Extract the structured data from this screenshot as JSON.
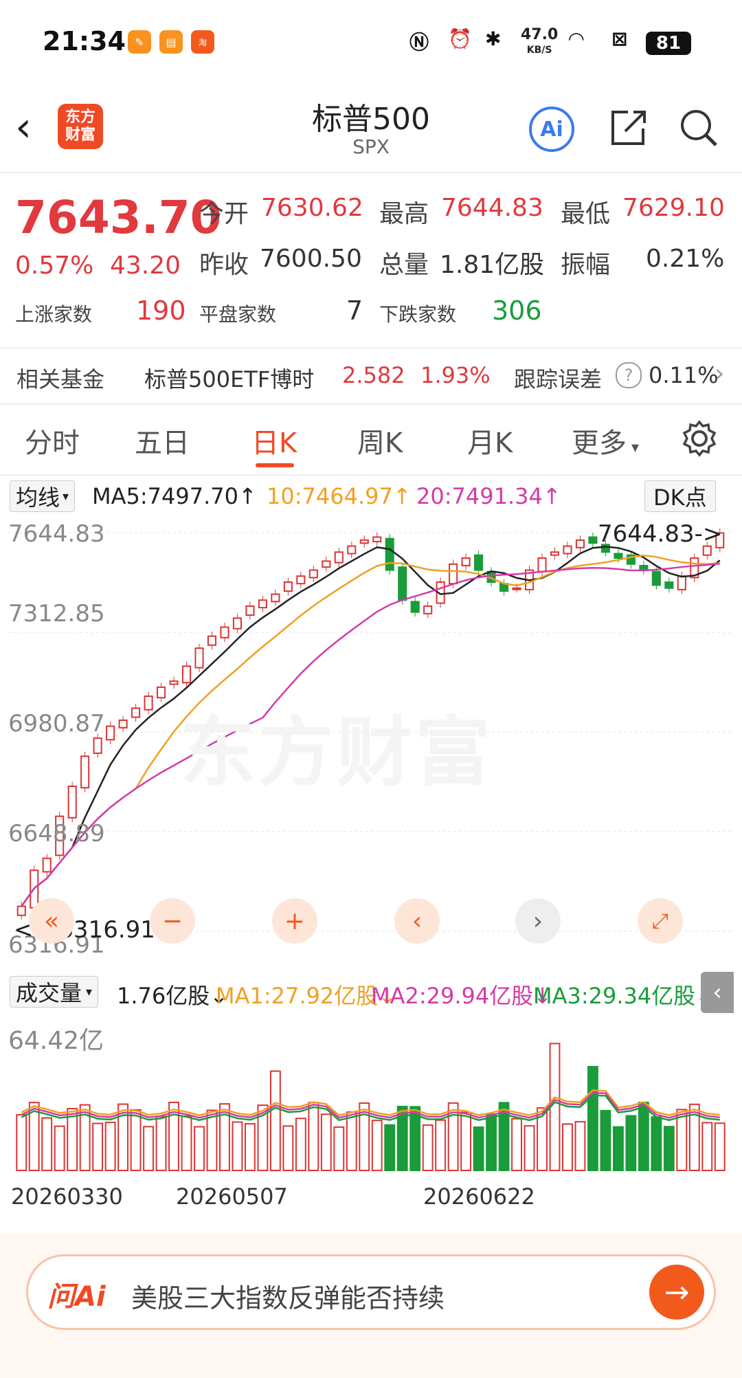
{
  "status_bar": {
    "time": "21:34",
    "network_speed": "47.0",
    "network_unit": "KB/S",
    "battery": "81"
  },
  "header": {
    "title": "标普500",
    "subtitle": "SPX",
    "logo_text_top": "东方",
    "logo_text_bottom": "财富",
    "ai_label": "Ai"
  },
  "quote": {
    "price": "7643.70",
    "change_pct": "0.57%",
    "change_val": "43.20",
    "open_label": "今开",
    "open": "7630.62",
    "high_label": "最高",
    "high": "7644.83",
    "low_label": "最低",
    "low": "7629.10",
    "prev_close_label": "昨收",
    "prev_close": "7600.50",
    "volume_label": "总量",
    "volume": "1.81亿股",
    "amplitude_label": "振幅",
    "amplitude": "0.21%",
    "up_label": "上涨家数",
    "up_count": "190",
    "flat_label": "平盘家数",
    "flat_count": "7",
    "down_label": "下跌家数",
    "down_count": "306"
  },
  "fund": {
    "label": "相关基金",
    "name": "标普500ETF博时",
    "price": "2.582",
    "pct": "1.93%",
    "tracking_label": "跟踪误差",
    "tracking_value": "0.11%"
  },
  "tabs": [
    "分时",
    "五日",
    "日K",
    "周K",
    "月K",
    "更多"
  ],
  "active_tab": "日K",
  "ma": {
    "selector": "均线",
    "ma5": "MA5:7497.70↑",
    "ma10": "10:7464.97↑",
    "ma20": "20:7491.34↑",
    "dk_button": "DK点",
    "ma10_color": "#f0a020",
    "ma20_color": "#d43aa8"
  },
  "main_chart": {
    "y_labels": [
      "7644.83",
      "7312.85",
      "6980.87",
      "6648.89",
      "6316.91"
    ],
    "high_marker": "7644.83->",
    "low_marker": "<---6316.91",
    "watermark": "东方财富"
  },
  "volume": {
    "selector": "成交量",
    "value": "1.76亿股↓",
    "ma1": "MA1:27.92亿股↓",
    "ma2": "MA2:29.94亿股↓",
    "ma3": "MA3:29.34亿股↓",
    "y_label": "64.42亿",
    "ma1_color": "#f0a020",
    "ma2_color": "#d43aa8",
    "ma3_color": "#1a9c3a"
  },
  "dates": [
    "20260330",
    "20260507",
    "20260622"
  ],
  "ask": {
    "logo": "问Ai",
    "text": "美股三大指数反弹能否持续"
  },
  "chart_data": {
    "type": "candlestick",
    "y_range": [
      6316.91,
      7644.83
    ],
    "close_series": [
      6400,
      6520,
      6560,
      6700,
      6800,
      6900,
      6960,
      7000,
      7020,
      7060,
      7100,
      7130,
      7150,
      7200,
      7260,
      7300,
      7330,
      7360,
      7400,
      7420,
      7440,
      7480,
      7500,
      7520,
      7550,
      7580,
      7600,
      7620,
      7630,
      7520,
      7420,
      7380,
      7400,
      7480,
      7540,
      7560,
      7520,
      7480,
      7450,
      7460,
      7520,
      7560,
      7580,
      7600,
      7620,
      7610,
      7580,
      7560,
      7540,
      7520,
      7470,
      7460,
      7500,
      7560,
      7600,
      7643.7
    ]
  }
}
